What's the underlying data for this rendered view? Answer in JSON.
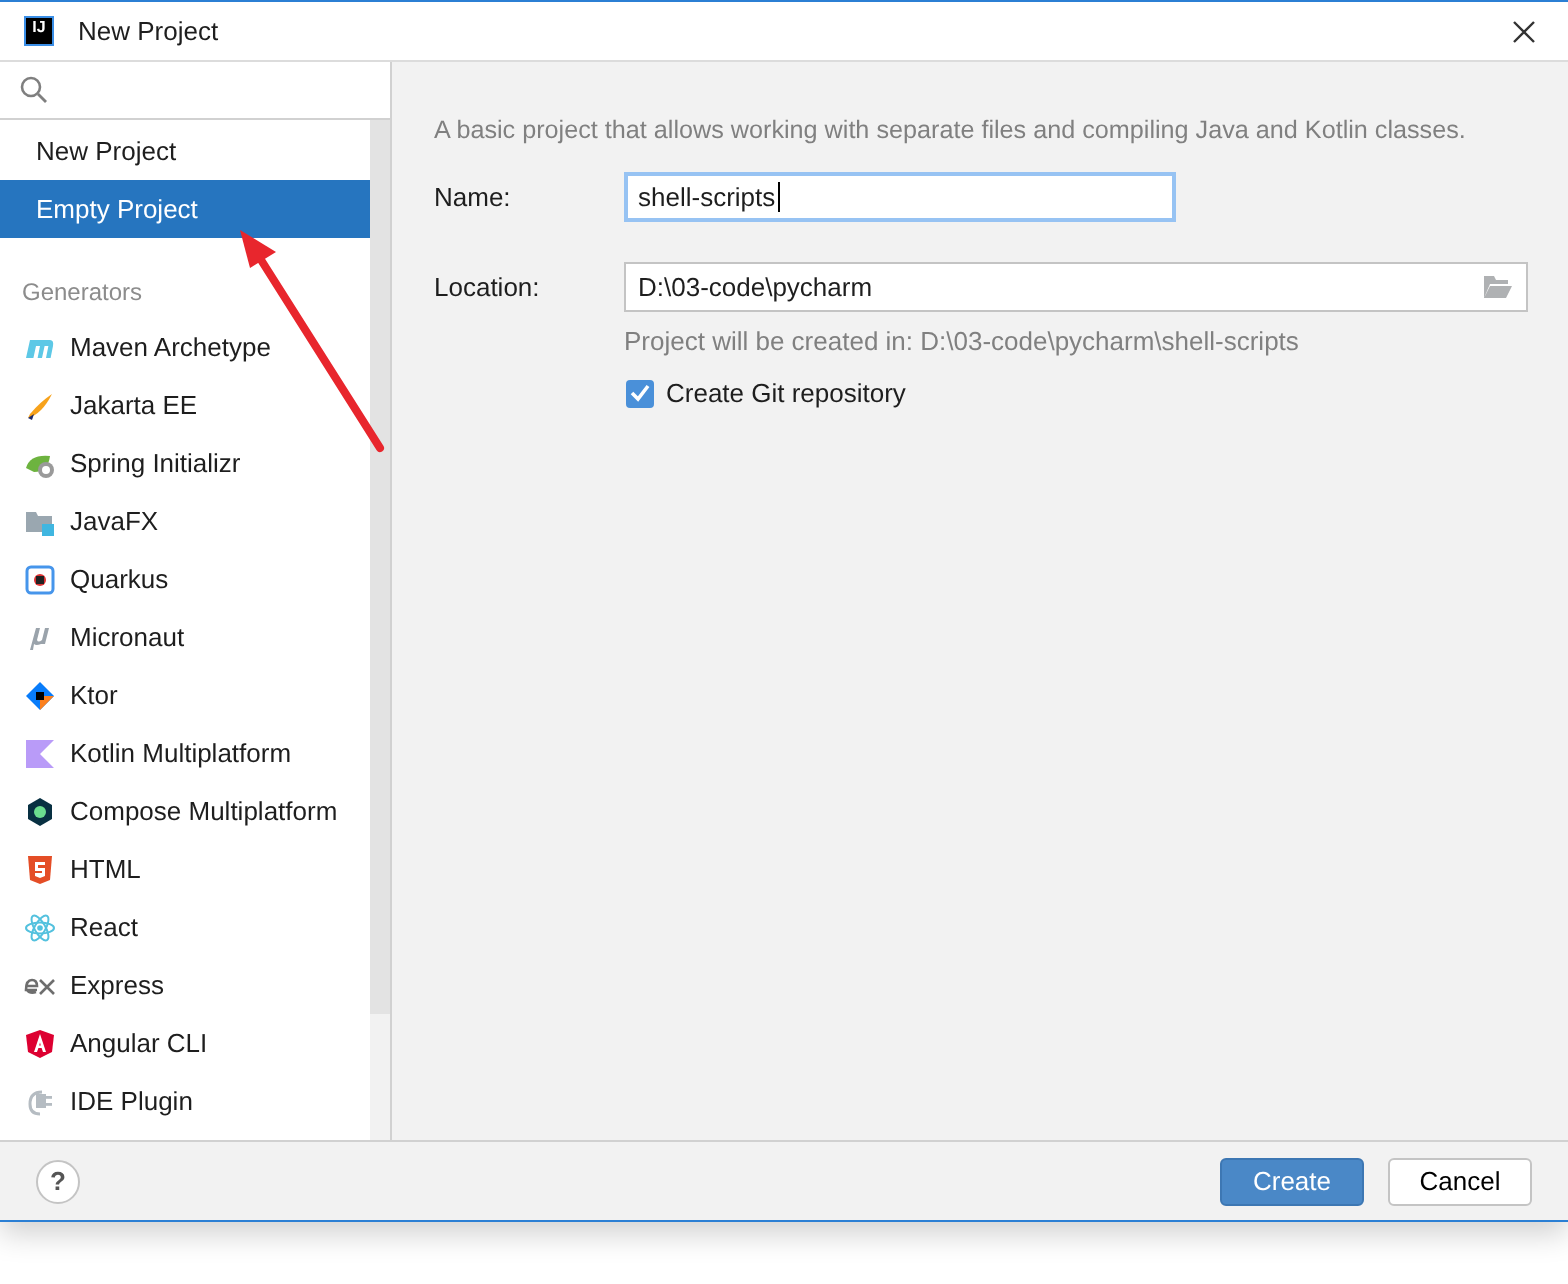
{
  "window": {
    "title": "New Project",
    "logo": "IJ"
  },
  "sidebar": {
    "items": [
      {
        "label": "New Project",
        "selected": false
      },
      {
        "label": "Empty Project",
        "selected": true
      }
    ],
    "section_title": "Generators",
    "generators": [
      {
        "label": "Maven Archetype",
        "selected": false
      },
      {
        "label": "Jakarta EE",
        "selected": false
      },
      {
        "label": "Spring Initializr",
        "selected": false
      },
      {
        "label": "JavaFX",
        "selected": false
      },
      {
        "label": "Quarkus",
        "selected": false
      },
      {
        "label": "Micronaut",
        "selected": false
      },
      {
        "label": "Ktor",
        "selected": false
      },
      {
        "label": "Kotlin Multiplatform",
        "selected": false
      },
      {
        "label": "Compose Multiplatform",
        "selected": false
      },
      {
        "label": "HTML",
        "selected": false
      },
      {
        "label": "React",
        "selected": false
      },
      {
        "label": "Express",
        "selected": false
      },
      {
        "label": "Angular CLI",
        "selected": false
      },
      {
        "label": "IDE Plugin",
        "selected": false
      }
    ]
  },
  "description": "A basic project that allows working with separate files and compiling Java and Kotlin classes.",
  "name_field": {
    "label": "Name:",
    "value": "shell-scripts",
    "focused": true
  },
  "location_field": {
    "label": "Location:",
    "value": "D:\\03-code\\pycharm",
    "focused": false
  },
  "location_hint": "Project will be created in: D:\\03-code\\pycharm\\shell-scripts",
  "git_checkbox": {
    "label": "Create Git repository",
    "checked": true
  },
  "help_button": "?",
  "buttons": [
    {
      "label": "Create",
      "default": true
    },
    {
      "label": "Cancel",
      "default": false
    }
  ]
}
